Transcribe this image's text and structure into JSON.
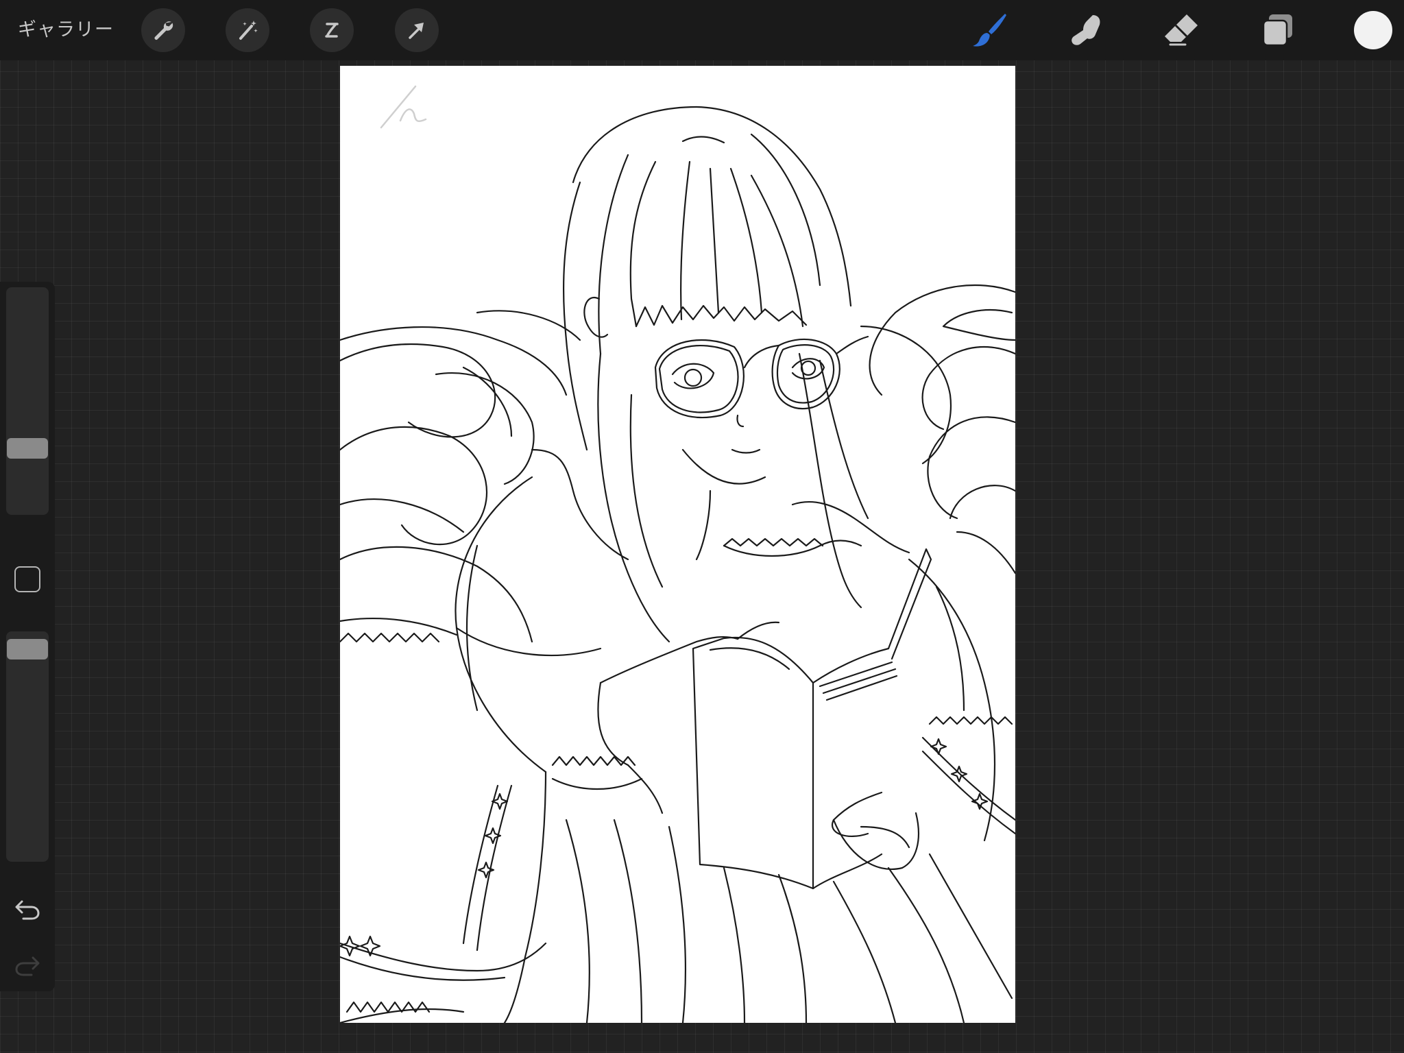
{
  "toolbar": {
    "gallery_label": "ギャラリー",
    "left_tools": [
      {
        "name": "actions",
        "icon": "wrench-icon"
      },
      {
        "name": "adjustments",
        "icon": "magic-wand-icon"
      },
      {
        "name": "selection",
        "icon": "selection-s-icon"
      },
      {
        "name": "transform",
        "icon": "arrow-cursor-icon"
      }
    ],
    "right_tools": [
      {
        "name": "brush",
        "icon": "brush-icon",
        "active": true
      },
      {
        "name": "smudge",
        "icon": "smudge-finger-icon",
        "active": false
      },
      {
        "name": "eraser",
        "icon": "eraser-icon",
        "active": false
      },
      {
        "name": "layers",
        "icon": "layers-icon",
        "active": false
      }
    ],
    "current_color": "#f2f2f2",
    "accent_color": "#2f6fd6"
  },
  "sidebar": {
    "brush_size_level": 0.27,
    "opacity_level": 0.97,
    "modify_icon": "square-icon",
    "undo_icon": "undo-arrow-icon",
    "redo_icon": "redo-arrow-icon",
    "redo_enabled": false
  },
  "canvas": {
    "background": "#ffffff",
    "content": "line-art-sketch"
  }
}
